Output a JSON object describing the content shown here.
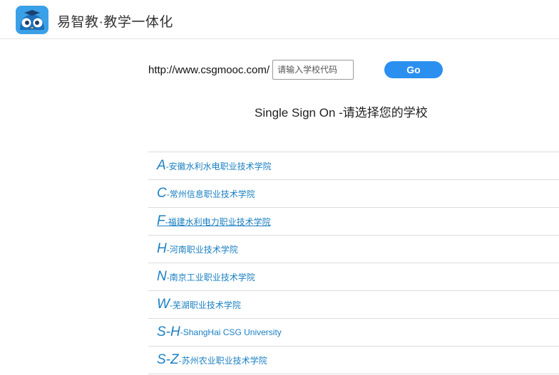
{
  "header": {
    "brand_title": "易智教·教学一体化",
    "logo_icon": "owl-logo-icon",
    "colors": {
      "logo_bg": "#3aa0e8",
      "owl_face": "#1c6fb8"
    }
  },
  "login": {
    "url_prefix": "http://www.csgmooc.com/",
    "code_placeholder": "请输入学校代码",
    "go_label": "Go",
    "sso_title": "Single Sign On -请选择您的学校",
    "colors": {
      "go_button": "#2b8ff0",
      "link": "#1a7fc1"
    }
  },
  "schools": [
    {
      "letter": "A",
      "name": "-安徽水利水电职业技术学院"
    },
    {
      "letter": "C",
      "name": "-常州信息职业技术学院"
    },
    {
      "letter": "F",
      "name": "-福建水利电力职业技术学院",
      "hover": true
    },
    {
      "letter": "H",
      "name": "-河南职业技术学院"
    },
    {
      "letter": "N",
      "name": "-南京工业职业技术学院"
    },
    {
      "letter": "W",
      "name": "-芜湖职业技术学院"
    },
    {
      "letter": "S-H",
      "name": "-ShangHai CSG University"
    },
    {
      "letter": "S-Z",
      "name": "-苏州农业职业技术学院"
    }
  ]
}
